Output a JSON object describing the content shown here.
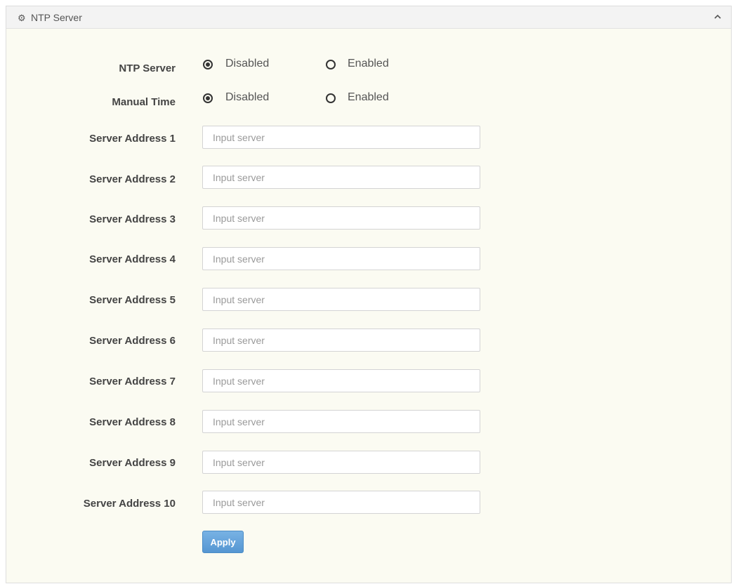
{
  "panel": {
    "title": "NTP Server",
    "icon": "gear-icon",
    "collapse_icon": "chevron-up-icon"
  },
  "ntp_server": {
    "label": "NTP Server",
    "options": [
      "Disabled",
      "Enabled"
    ],
    "selected": "Disabled"
  },
  "manual_time": {
    "label": "Manual Time",
    "options": [
      "Disabled",
      "Enabled"
    ],
    "selected": "Disabled"
  },
  "servers": [
    {
      "label": "Server Address 1",
      "value": "",
      "placeholder": "Input server"
    },
    {
      "label": "Server Address 2",
      "value": "",
      "placeholder": "Input server"
    },
    {
      "label": "Server Address 3",
      "value": "",
      "placeholder": "Input server"
    },
    {
      "label": "Server Address 4",
      "value": "",
      "placeholder": "Input server"
    },
    {
      "label": "Server Address 5",
      "value": "",
      "placeholder": "Input server"
    },
    {
      "label": "Server Address 6",
      "value": "",
      "placeholder": "Input server"
    },
    {
      "label": "Server Address 7",
      "value": "",
      "placeholder": "Input server"
    },
    {
      "label": "Server Address 8",
      "value": "",
      "placeholder": "Input server"
    },
    {
      "label": "Server Address 9",
      "value": "",
      "placeholder": "Input server"
    },
    {
      "label": "Server Address 10",
      "value": "",
      "placeholder": "Input server"
    }
  ],
  "apply_label": "Apply",
  "colors": {
    "panel_background": "#fbfbf2",
    "header_background": "#f3f3f3",
    "apply_button": "#5b9bd5"
  }
}
